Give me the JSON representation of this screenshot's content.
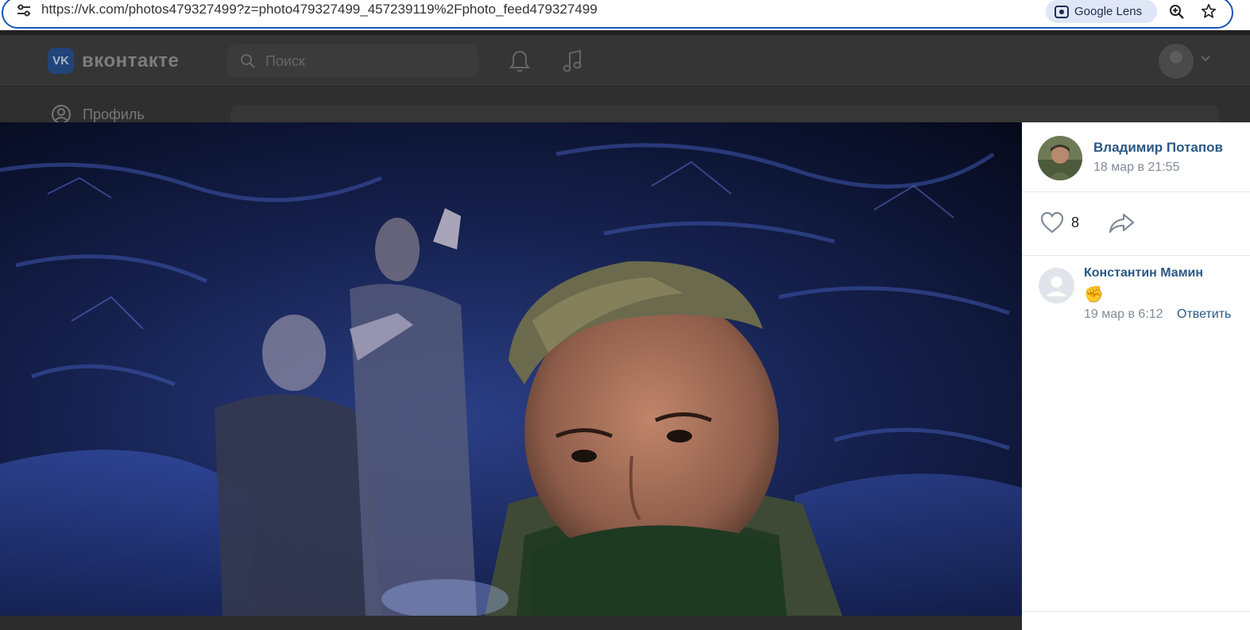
{
  "browser": {
    "url": "https://vk.com/photos479327499?z=photo479327499_457239119%2Fphoto_feed479327499",
    "lens_label": "Google Lens",
    "icons": [
      "tune-icon",
      "google-lens-icon",
      "zoom-icon",
      "bookmark-star-icon"
    ]
  },
  "vk": {
    "logo_mark": "VK",
    "logo_text": "вконтакте",
    "search_placeholder": "Поиск",
    "sidebar_profile": "Профиль",
    "icons": [
      "search-icon",
      "bell-icon",
      "music-icon",
      "chevron-down-icon",
      "profile-icon"
    ]
  },
  "post": {
    "author_name": "Владимир Потапов",
    "date": "18 мар в 21:55",
    "likes": "8",
    "icons": [
      "heart-icon",
      "share-icon"
    ]
  },
  "comments": [
    {
      "author": "Константин Мамин",
      "text": "✊",
      "date": "19 мар в 6:12",
      "reply_label": "Ответить"
    }
  ],
  "colors": {
    "link": "#2a5885",
    "muted": "#818c99",
    "address_focus": "#1a56b8",
    "lens_chip": "#dfe7f6"
  }
}
